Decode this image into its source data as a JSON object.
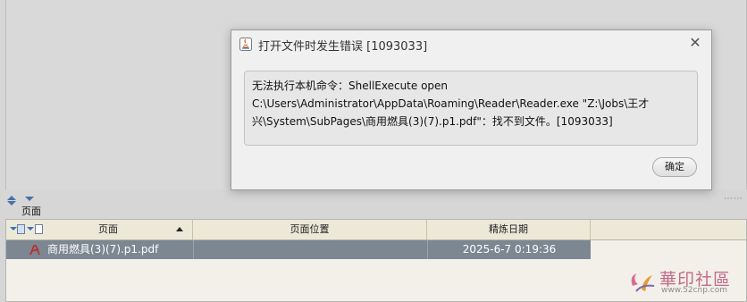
{
  "pane": {
    "title": "页面"
  },
  "table": {
    "columns": [
      "页面",
      "页面位置",
      "精炼日期"
    ],
    "rows": [
      {
        "page": "商用燃具(3)(7).p1.pdf",
        "location": "",
        "date": "2025-6-7 0:19:36"
      }
    ]
  },
  "dialog": {
    "title": "打开文件时发生错误 [1093033]",
    "message_lines": [
      "无法执行本机命令：ShellExecute open",
      "C:\\Users\\Administrator\\AppData\\Roaming\\Reader\\Reader.exe \"Z:\\Jobs\\王才",
      "兴\\System\\SubPages\\商用燃具(3)(7).p1.pdf\"：找不到文件。[1093033]"
    ],
    "ok_label": "确定"
  },
  "watermark": {
    "title": "華印社區",
    "url": "www.52cnp.com"
  },
  "colors": {
    "selected_row": "#7c8792",
    "header_bg": "#ece9d8",
    "pdf_red": "#c0262b"
  }
}
